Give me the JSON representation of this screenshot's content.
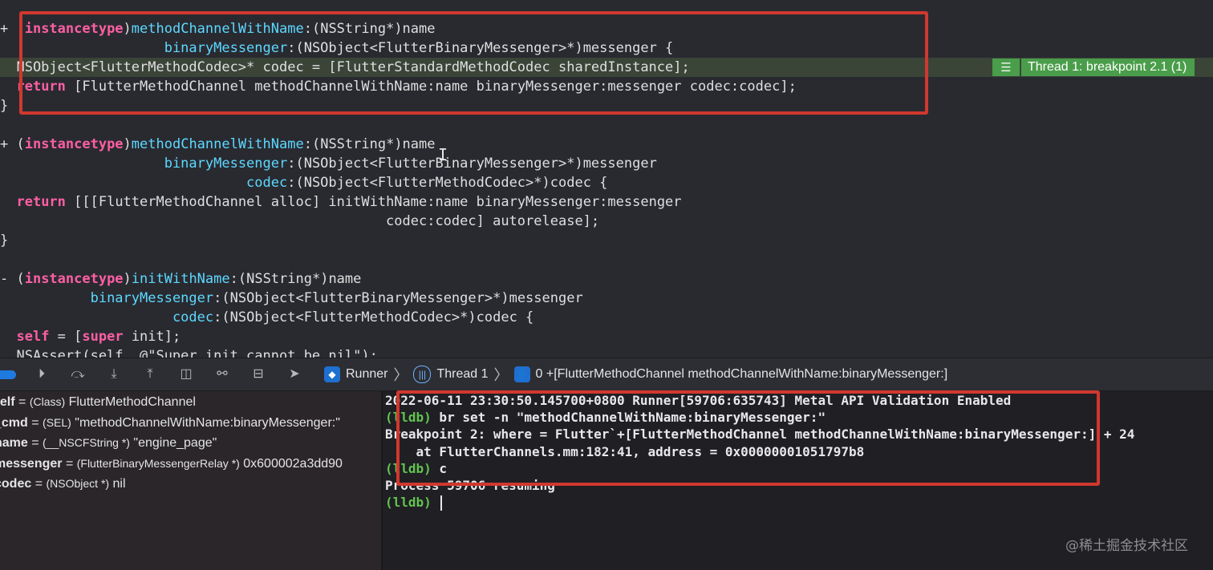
{
  "editor": {
    "lines": [
      {
        "segments": [
          {
            "t": "+ ("
          },
          {
            "t": "instancetype",
            "c": "kw"
          },
          {
            "t": ")"
          },
          {
            "t": "methodChannelWithName",
            "c": "meth"
          },
          {
            "t": ":(NSString*)name"
          }
        ]
      },
      {
        "segments": [
          {
            "t": "                    "
          },
          {
            "t": "binaryMessenger",
            "c": "meth"
          },
          {
            "t": ":(NSObject<FlutterBinaryMessenger>*)messenger {"
          }
        ]
      },
      {
        "segments": [
          {
            "t": "  NSObject<FlutterMethodCodec>* codec = [FlutterStandardMethodCodec sharedInstance];"
          }
        ]
      },
      {
        "segments": [
          {
            "t": "  "
          },
          {
            "t": "return",
            "c": "kw"
          },
          {
            "t": " [FlutterMethodChannel methodChannelWithName:name binaryMessenger:messenger codec:codec];"
          }
        ]
      },
      {
        "segments": [
          {
            "t": "}"
          }
        ]
      },
      {
        "segments": [
          {
            "t": ""
          }
        ]
      },
      {
        "segments": [
          {
            "t": "+ ("
          },
          {
            "t": "instancetype",
            "c": "kw"
          },
          {
            "t": ")"
          },
          {
            "t": "methodChannelWithName",
            "c": "meth"
          },
          {
            "t": ":(NSString*)name"
          }
        ]
      },
      {
        "segments": [
          {
            "t": "                    "
          },
          {
            "t": "binaryMessenger",
            "c": "meth"
          },
          {
            "t": ":(NSObject<FlutterBinaryMessenger>*)messenger"
          }
        ]
      },
      {
        "segments": [
          {
            "t": "                              "
          },
          {
            "t": "codec",
            "c": "meth"
          },
          {
            "t": ":(NSObject<FlutterMethodCodec>*)codec {"
          }
        ]
      },
      {
        "segments": [
          {
            "t": "  "
          },
          {
            "t": "return",
            "c": "kw"
          },
          {
            "t": " [[[FlutterMethodChannel alloc] initWithName:name binaryMessenger:messenger"
          }
        ]
      },
      {
        "segments": [
          {
            "t": "                                               codec:codec] autorelease];"
          }
        ]
      },
      {
        "segments": [
          {
            "t": "}"
          }
        ]
      },
      {
        "segments": [
          {
            "t": ""
          }
        ]
      },
      {
        "segments": [
          {
            "t": "- ("
          },
          {
            "t": "instancetype",
            "c": "kw"
          },
          {
            "t": ")"
          },
          {
            "t": "initWithName",
            "c": "meth"
          },
          {
            "t": ":(NSString*)name"
          }
        ]
      },
      {
        "segments": [
          {
            "t": "           "
          },
          {
            "t": "binaryMessenger",
            "c": "meth"
          },
          {
            "t": ":(NSObject<FlutterBinaryMessenger>*)messenger"
          }
        ]
      },
      {
        "segments": [
          {
            "t": "                     "
          },
          {
            "t": "codec",
            "c": "meth"
          },
          {
            "t": ":(NSObject<FlutterMethodCodec>*)codec {"
          }
        ]
      },
      {
        "segments": [
          {
            "t": "  "
          },
          {
            "t": "self",
            "c": "kw"
          },
          {
            "t": " = ["
          },
          {
            "t": "super",
            "c": "kw"
          },
          {
            "t": " init];"
          }
        ]
      },
      {
        "segments": [
          {
            "t": "  NSAssert(self, @\"Super init cannot be nil\");"
          }
        ]
      }
    ],
    "breakpoint_annotation": "Thread 1: breakpoint 2.1 (1)",
    "breakpoint_icon": "list-icon"
  },
  "debug_bar": {
    "buttons": [
      "breakpoints-toggle",
      "continue",
      "step-over",
      "step-into",
      "step-out",
      "view-hierarchy",
      "memory-graph",
      "environment-overrides",
      "simulate-location"
    ],
    "breadcrumbs": [
      "Runner",
      "Thread 1",
      "0 +[FlutterMethodChannel methodChannelWithName:binaryMessenger:]"
    ],
    "crumb_icons": [
      "flutter-icon",
      "thread-icon",
      "stack-frame-icon"
    ]
  },
  "variables": [
    {
      "name": "self",
      "type": "(Class)",
      "value": "FlutterMethodChannel"
    },
    {
      "name": "_cmd",
      "type": "(SEL)",
      "value": "\"methodChannelWithName:binaryMessenger:\""
    },
    {
      "name": "name",
      "type": "(__NSCFString *)",
      "value": "\"engine_page\""
    },
    {
      "name": "messenger",
      "type": "(FlutterBinaryMessengerRelay *)",
      "value": "0x600002a3dd90"
    },
    {
      "name": "codec",
      "type": "(NSObject *)",
      "value": "nil"
    }
  ],
  "console": {
    "lines": [
      {
        "prompt": "",
        "text": "2022-06-11 23:30:50.145700+0800 Runner[59706:635743] Metal API Validation Enabled"
      },
      {
        "prompt": "(lldb)",
        "text": " br set -n \"methodChannelWithName:binaryMessenger:\""
      },
      {
        "prompt": "",
        "text": "Breakpoint 2: where = Flutter`+[FlutterMethodChannel methodChannelWithName:binaryMessenger:] + 24"
      },
      {
        "prompt": "",
        "text": "    at FlutterChannels.mm:182:41, address = 0x00000001051797b8"
      },
      {
        "prompt": "(lldb)",
        "text": " c"
      },
      {
        "prompt": "",
        "text": "Process 59706 resuming"
      },
      {
        "prompt": "(lldb)",
        "text": " "
      }
    ]
  },
  "watermark": "@稀土掘金技术社区",
  "colors": {
    "keyword": "#fc5fa3",
    "method": "#5dd8ff",
    "annotation": "#4a9d4a",
    "highlight": "#d0382f",
    "lldb_prompt": "#62c44e"
  }
}
